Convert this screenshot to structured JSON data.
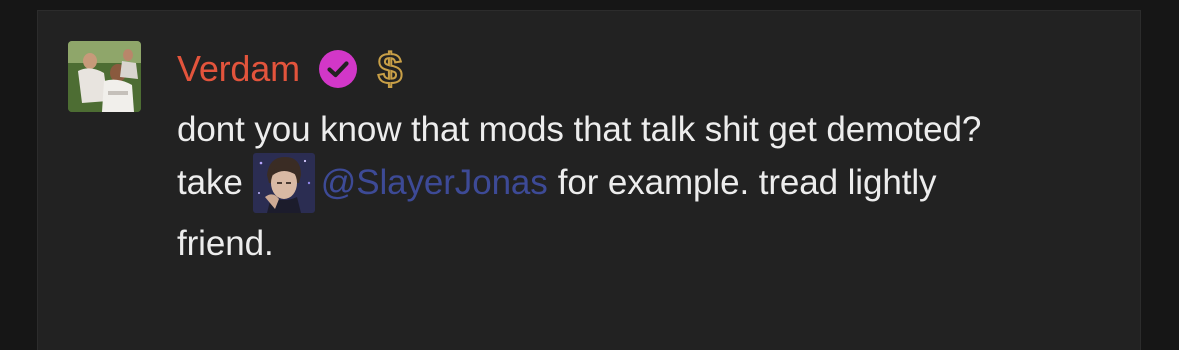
{
  "message": {
    "author": {
      "name": "Verdam",
      "name_color": "#e3543c",
      "badges": [
        "verified-check-icon",
        "dollar-sign-icon"
      ],
      "avatar": "user-avatar"
    },
    "lines": [
      "dont you know that mods that talk shit get demoted?",
      "take",
      "for example. tread lightly",
      "friend."
    ],
    "mention": {
      "handle": "@SlayerJonas",
      "color": "#3d4a96",
      "avatar": "mention-avatar"
    }
  },
  "colors": {
    "background": "#161616",
    "panel": "#222222",
    "verified_badge": "#d237c8",
    "money_badge": "#c9a047"
  }
}
